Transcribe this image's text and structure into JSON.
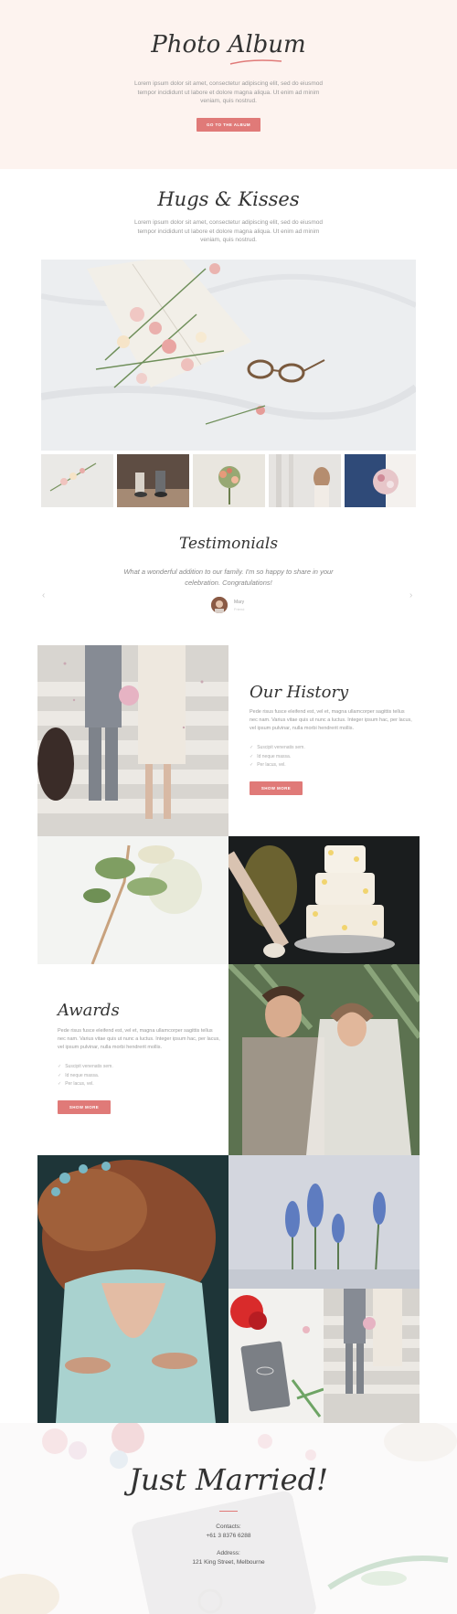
{
  "hero": {
    "title": "Photo Album",
    "text": "Lorem ipsum dolor sit amet, consectetur adipiscing elit, sed do eiusmod tempor incididunt ut labore et dolore magna aliqua. Ut enim ad minim veniam, quis nostrud.",
    "button_label": "GO TO THE ALBUM"
  },
  "hugs": {
    "title": "Hugs & Kisses",
    "text": "Lorem ipsum dolor sit amet, consectetur adipiscing elit, sed do eiusmod tempor incididunt ut labore et dolore magna aliqua. Ut enim ad minim veniam, quis nostrud."
  },
  "testimonials": {
    "title": "Testimonials",
    "quote": "What a wonderful addition to our family. I'm so happy to share in your celebration. Congratulations!",
    "name": "Mary",
    "role": "Friend",
    "prev_icon": "chevron-left-icon",
    "next_icon": "chevron-right-icon"
  },
  "history": {
    "title": "Our History",
    "text": "Pede risus fusce eleifend est, vel et, magna ullamcorper sagittis tellus nec nam. Varius vitae quis ut nunc a luctus. Integer ipsum hac, per lacus, vel ipsum pulvinar, nulla morbi hendrerit mollis.",
    "items": [
      "Suscipit venenatis sem.",
      "Id neque massa.",
      "Per lacus, vel."
    ],
    "button_label": "SHOW MORE"
  },
  "awards": {
    "title": "Awards",
    "text": "Pede risus fusce eleifend est, vel et, magna ullamcorper sagittis tellus nec nam. Varius vitae quis ut nunc a luctus. Integer ipsum hac, per lacus, vel ipsum pulvinar, nulla morbi hendrerit mollis.",
    "items": [
      "Suscipit venenatis sem.",
      "Id neque massa.",
      "Per lacus, vel."
    ],
    "button_label": "SHOW MORE"
  },
  "footer": {
    "title": "Just Married!",
    "contacts_label": "Contacts:",
    "phone": "+61 3 8376 6288",
    "address_label": "Address:",
    "address": "121 King Street, Melbourne"
  },
  "colors": {
    "accent": "#e07a78",
    "hero_bg": "#fdf3ef"
  }
}
